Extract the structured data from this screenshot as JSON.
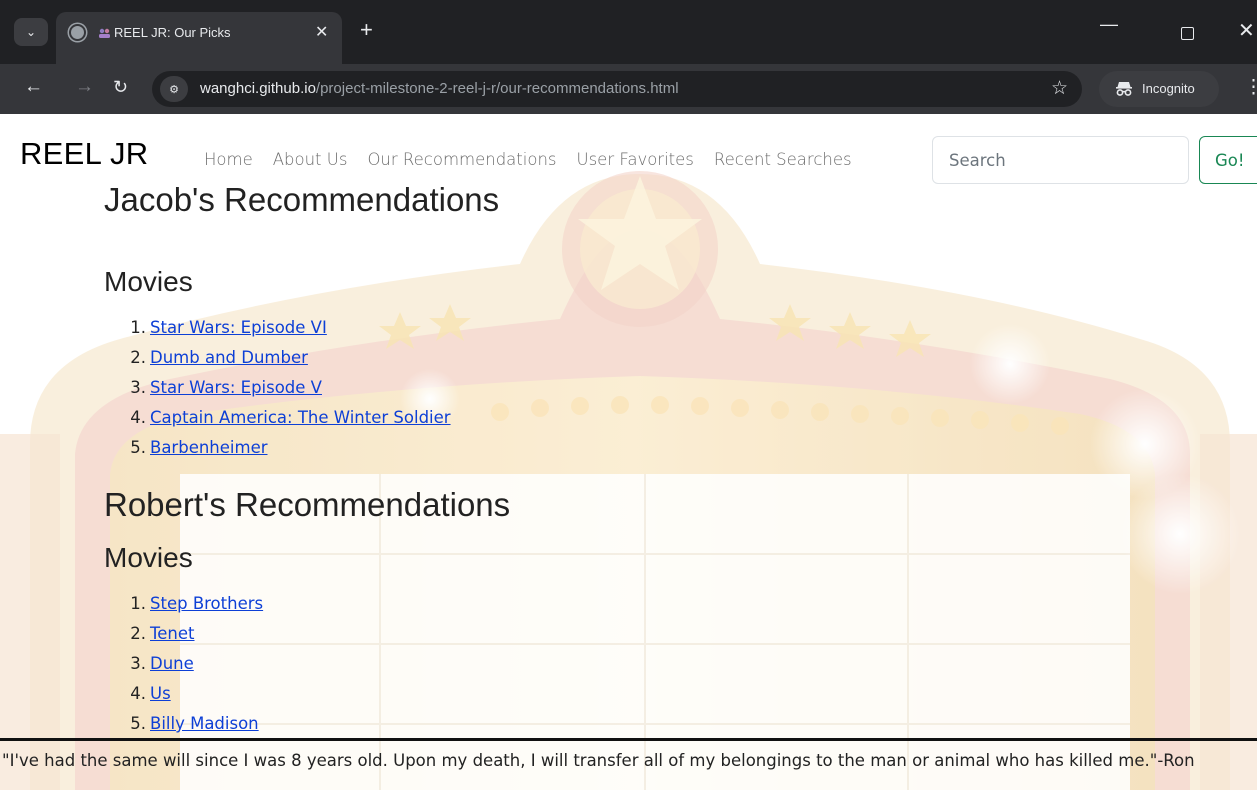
{
  "browser": {
    "tab_title": "REEL JR: Our Picks",
    "url_host": "wanghci.github.io",
    "url_path": "/project-milestone-2-reel-j-r/our-recommendations.html",
    "incognito_label": "Incognito"
  },
  "navbar": {
    "brand": "REEL JR",
    "links": [
      "Home",
      "About Us",
      "Our Recommendations",
      "User Favorites",
      "Recent Searches"
    ],
    "search_placeholder": "Search",
    "go_label": "Go!"
  },
  "sections": [
    {
      "heading": "Jacob's Recommendations",
      "subheading": "Movies",
      "movies": [
        "Star Wars: Episode VI",
        "Dumb and Dumber",
        "Star Wars: Episode V",
        "Captain America: The Winter Soldier",
        "Barbenheimer"
      ]
    },
    {
      "heading": "Robert's Recommendations",
      "subheading": "Movies",
      "movies": [
        "Step Brothers",
        "Tenet",
        "Dune",
        "Us",
        "Billy Madison"
      ]
    }
  ],
  "footer": {
    "quote": "\"I've had the same will since I was 8 years old. Upon my death, I will transfer all of my belongings to the man or animal who has killed me.\"-Ron"
  },
  "colors": {
    "link": "#0d3fd6",
    "go_button": "#198754",
    "chrome_dark": "#202124",
    "chrome_mid": "#35363a"
  }
}
